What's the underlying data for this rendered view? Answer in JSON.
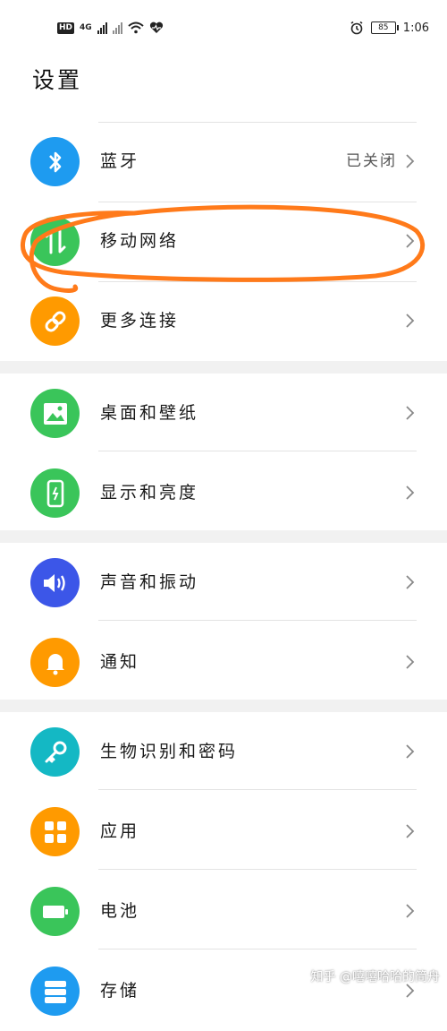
{
  "statusbar": {
    "network_label": "4G",
    "battery": "85",
    "time": "1:06"
  },
  "page": {
    "title": "设置"
  },
  "groups": [
    {
      "items": [
        {
          "label": "蓝牙",
          "value": "已关闭",
          "icon": "bluetooth-icon",
          "color": "#1e9bf0"
        },
        {
          "label": "移动网络",
          "icon": "mobile-data-icon",
          "color": "#3ac55a"
        },
        {
          "label": "更多连接",
          "icon": "link-icon",
          "color": "#ff9a00"
        }
      ]
    },
    {
      "items": [
        {
          "label": "桌面和壁纸",
          "icon": "wallpaper-icon",
          "color": "#3ac55a"
        },
        {
          "label": "显示和亮度",
          "icon": "display-icon",
          "color": "#3ac55a"
        }
      ]
    },
    {
      "items": [
        {
          "label": "声音和振动",
          "icon": "sound-icon",
          "color": "#3c56e8"
        },
        {
          "label": "通知",
          "icon": "bell-icon",
          "color": "#ff9a00"
        }
      ]
    },
    {
      "items": [
        {
          "label": "生物识别和密码",
          "icon": "key-icon",
          "color": "#14b8c4"
        },
        {
          "label": "应用",
          "icon": "apps-icon",
          "color": "#ff9a00"
        },
        {
          "label": "电池",
          "icon": "battery-icon",
          "color": "#3ac55a"
        },
        {
          "label": "存储",
          "icon": "storage-icon",
          "color": "#1e9bf0"
        }
      ]
    }
  ],
  "watermark": "知乎 @嘻嘻哈哈的简舟",
  "annotation_color": "#ff7a1a"
}
